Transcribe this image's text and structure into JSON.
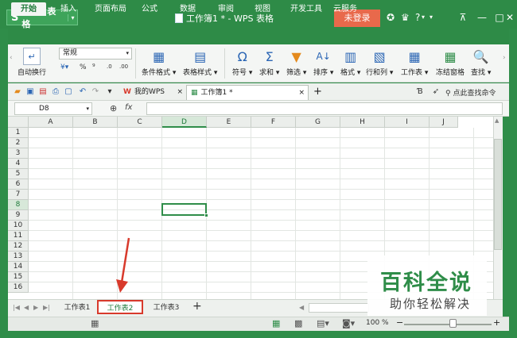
{
  "titlebar": {
    "app_label": "WPS 表格",
    "doc_title": "工作簿1 * - WPS 表格",
    "login_button": "未登录",
    "icons": [
      "skin-icon",
      "shirt-icon",
      "help-icon",
      "ribbon-toggle-icon",
      "minimize-icon",
      "restore-icon",
      "close-icon"
    ],
    "help_text": "?"
  },
  "menu": {
    "tabs": [
      "开始",
      "插入",
      "页面布局",
      "公式",
      "数据",
      "审阅",
      "视图",
      "开发工具",
      "云服务"
    ],
    "active": "开始"
  },
  "ribbon": {
    "wrap_label": "自动换行",
    "number_format": "常规",
    "number_mini": [
      "%",
      "⁹",
      "⁰⁰",
      ".0",
      ".00"
    ],
    "buttons": [
      {
        "label": "条件格式 ▾",
        "icon": "conditional-format-icon"
      },
      {
        "label": "表格样式 ▾",
        "icon": "table-style-icon"
      },
      {
        "label": "符号 ▾",
        "icon": "omega-icon",
        "glyph": "Ω"
      },
      {
        "label": "求和 ▾",
        "icon": "sigma-icon",
        "glyph": "Σ"
      },
      {
        "label": "筛选 ▾",
        "icon": "filter-icon"
      },
      {
        "label": "排序 ▾",
        "icon": "sort-icon"
      },
      {
        "label": "格式 ▾",
        "icon": "format-icon"
      },
      {
        "label": "行和列 ▾",
        "icon": "row-col-icon"
      },
      {
        "label": "工作表 ▾",
        "icon": "worksheet-icon"
      },
      {
        "label": "冻结窗格",
        "icon": "freeze-panes-icon"
      },
      {
        "label": "查找 ▾",
        "icon": "find-icon"
      }
    ]
  },
  "doc_tabs": {
    "tabs": [
      {
        "label": "我的WPS",
        "close": "×"
      },
      {
        "label": "工作簿1 *",
        "close": "×"
      }
    ],
    "add": "+",
    "search_cmd": "点此查找命令"
  },
  "formula_bar": {
    "cell_ref": "D8",
    "fx": "fx",
    "value": ""
  },
  "grid": {
    "columns": [
      "A",
      "B",
      "C",
      "D",
      "E",
      "F",
      "G",
      "H",
      "I",
      "J"
    ],
    "rows": [
      "1",
      "2",
      "3",
      "4",
      "5",
      "6",
      "7",
      "8",
      "9",
      "10",
      "11",
      "12",
      "13",
      "14",
      "15",
      "16"
    ],
    "active_column": "D",
    "active_row": "8"
  },
  "sheets": {
    "tabs": [
      "工作表1",
      "工作表2",
      "工作表3"
    ],
    "active": "工作表2",
    "add": "+"
  },
  "status": {
    "zoom": "100 %",
    "zoom_minus": "−",
    "zoom_plus": "+",
    "zoom_fraction": 0.55
  },
  "watermark": {
    "title": "百科全说",
    "subtitle": "助你轻松解决"
  },
  "colors": {
    "brand": "#2f8d49",
    "login": "#e8694b",
    "annotation": "#d83a2c"
  }
}
